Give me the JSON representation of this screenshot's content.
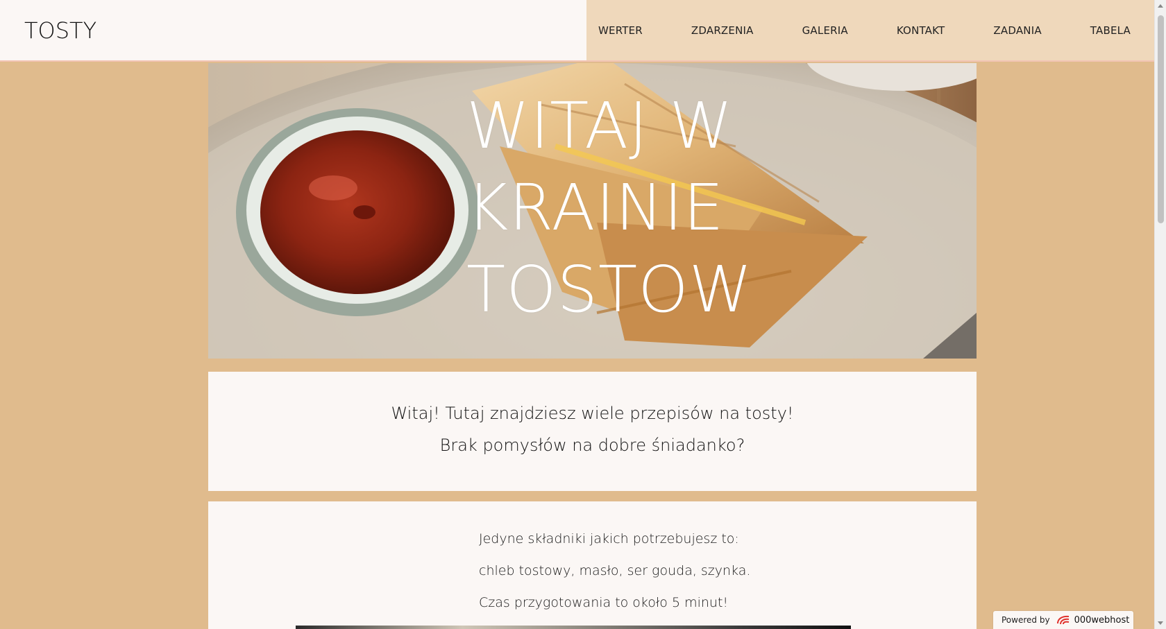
{
  "header": {
    "brand": "TOSTY",
    "nav": [
      {
        "label": "WERTER"
      },
      {
        "label": "ZDARZENIA"
      },
      {
        "label": "GALERIA"
      },
      {
        "label": "KONTAKT"
      },
      {
        "label": "ZADANIA"
      },
      {
        "label": "TABELA"
      }
    ]
  },
  "hero": {
    "title": "WITAJ W\nKRAINIE\nTOSTOW"
  },
  "intro": {
    "line1": "Witaj! Tutaj znajdziesz wiele przepisów na tosty!",
    "line2": "Brak pomysłów na dobre śniadanko?"
  },
  "ingredients": {
    "line1": "Jedyne składniki jakich potrzebujesz to:",
    "line2": "chleb tostowy, masło, ser gouda, szynka.",
    "line3": "Czas przygotowania to około 5 minut!"
  },
  "badge": {
    "powered_by": "Powered by",
    "brand": "000webhost"
  },
  "colors": {
    "page_background": "#e0bb8d",
    "card_background": "#fbf7f5",
    "nav_background": "#efd8bb",
    "hero_text": "#ffffff"
  },
  "icons": {
    "badge_logo": "000webhost-logo-icon"
  }
}
